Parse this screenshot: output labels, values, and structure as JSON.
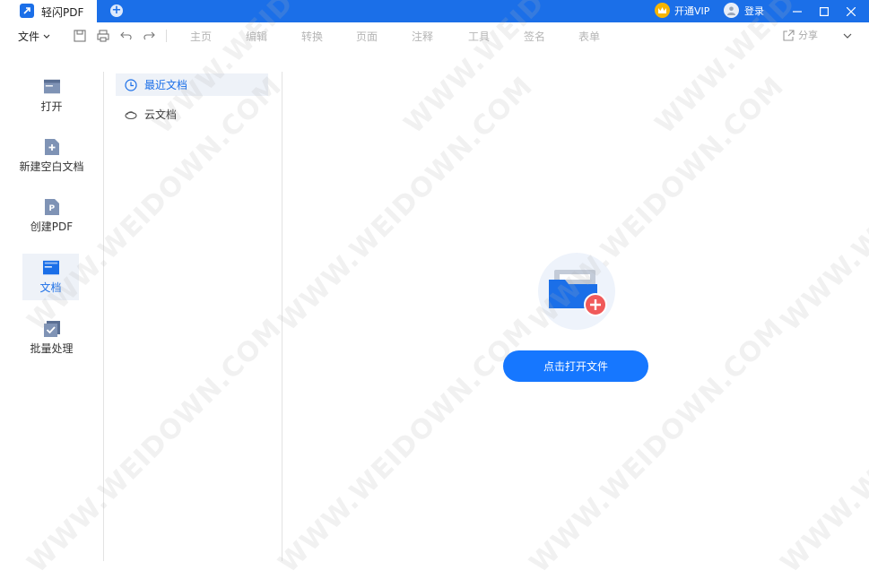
{
  "titlebar": {
    "app_title": "轻闪PDF",
    "vip_label": "开通VIP",
    "login_label": "登录"
  },
  "menubar": {
    "file_label": "文件",
    "items": [
      "主页",
      "编辑",
      "转换",
      "页面",
      "注释",
      "工具",
      "签名",
      "表单"
    ],
    "share_label": "分享"
  },
  "leftnav": {
    "items": [
      {
        "label": "打开",
        "icon": "folder-icon"
      },
      {
        "label": "新建空白文档",
        "icon": "new-file-icon"
      },
      {
        "label": "创建PDF",
        "icon": "pdf-icon"
      },
      {
        "label": "文档",
        "icon": "document-folder-icon",
        "active": true
      },
      {
        "label": "批量处理",
        "icon": "batch-icon"
      }
    ]
  },
  "subnav": {
    "items": [
      {
        "label": "最近文档",
        "icon": "clock-icon",
        "active": true
      },
      {
        "label": "云文档",
        "icon": "cloud-icon"
      }
    ]
  },
  "main": {
    "open_button_label": "点击打开文件"
  },
  "watermark": "WWW.WEIDOWN.COM",
  "colors": {
    "brand": "#1b6fe8",
    "button": "#1677ff",
    "active_bg": "#eef2f8",
    "vip": "#f7b500",
    "plus_badge": "#f05a5a"
  }
}
